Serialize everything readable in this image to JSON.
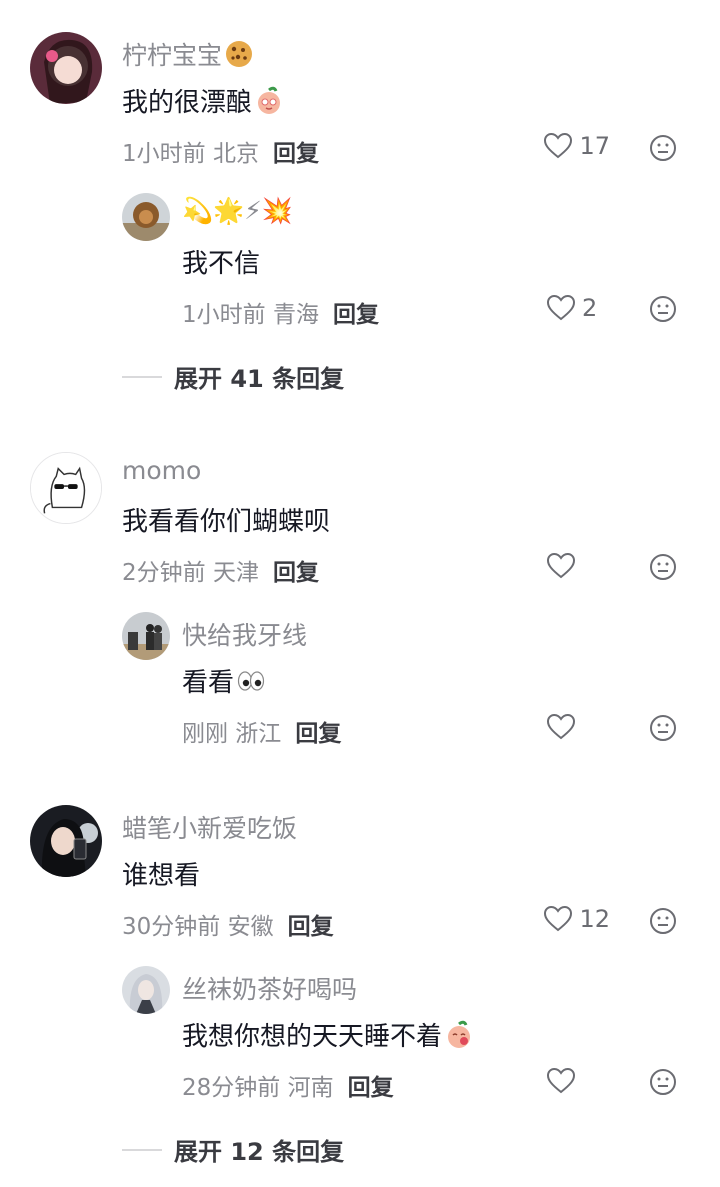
{
  "comments": [
    {
      "name": "柠柠宝宝",
      "text": "我的很漂酿",
      "time_loc": "1小时前 北京",
      "reply_label": "回复",
      "likes": "17",
      "replies": [
        {
          "name": "💫🌟⚡💥",
          "text": "我不信",
          "time_loc": "1小时前 青海",
          "reply_label": "回复",
          "likes": "2"
        }
      ],
      "expand_label": "展开 41 条回复"
    },
    {
      "name": "momo",
      "text": "我看看你们蝴蝶呗",
      "time_loc": "2分钟前 天津",
      "reply_label": "回复",
      "likes": "",
      "replies": [
        {
          "name": "快给我牙线",
          "text": "看看",
          "time_loc": "刚刚 浙江",
          "reply_label": "回复",
          "likes": ""
        }
      ]
    },
    {
      "name": "蜡笔小新爱吃饭",
      "text": "谁想看",
      "time_loc": "30分钟前 安徽",
      "reply_label": "回复",
      "likes": "12",
      "replies": [
        {
          "name": "丝袜奶茶好喝吗",
          "text": "我想你想的天天睡不着",
          "time_loc": "28分钟前 河南",
          "reply_label": "回复",
          "likes": ""
        }
      ],
      "expand_label": "展开 12 条回复"
    }
  ],
  "icons": {
    "like": "heart-outline-icon",
    "dislike": "meh-face-icon",
    "cookie": "cookie-emoji",
    "peach": "peach-face-emoji",
    "eyes": "eyes-emoji"
  },
  "colors": {
    "name": "#8a8b91",
    "text": "#161823",
    "reply": "#3a3b41"
  }
}
